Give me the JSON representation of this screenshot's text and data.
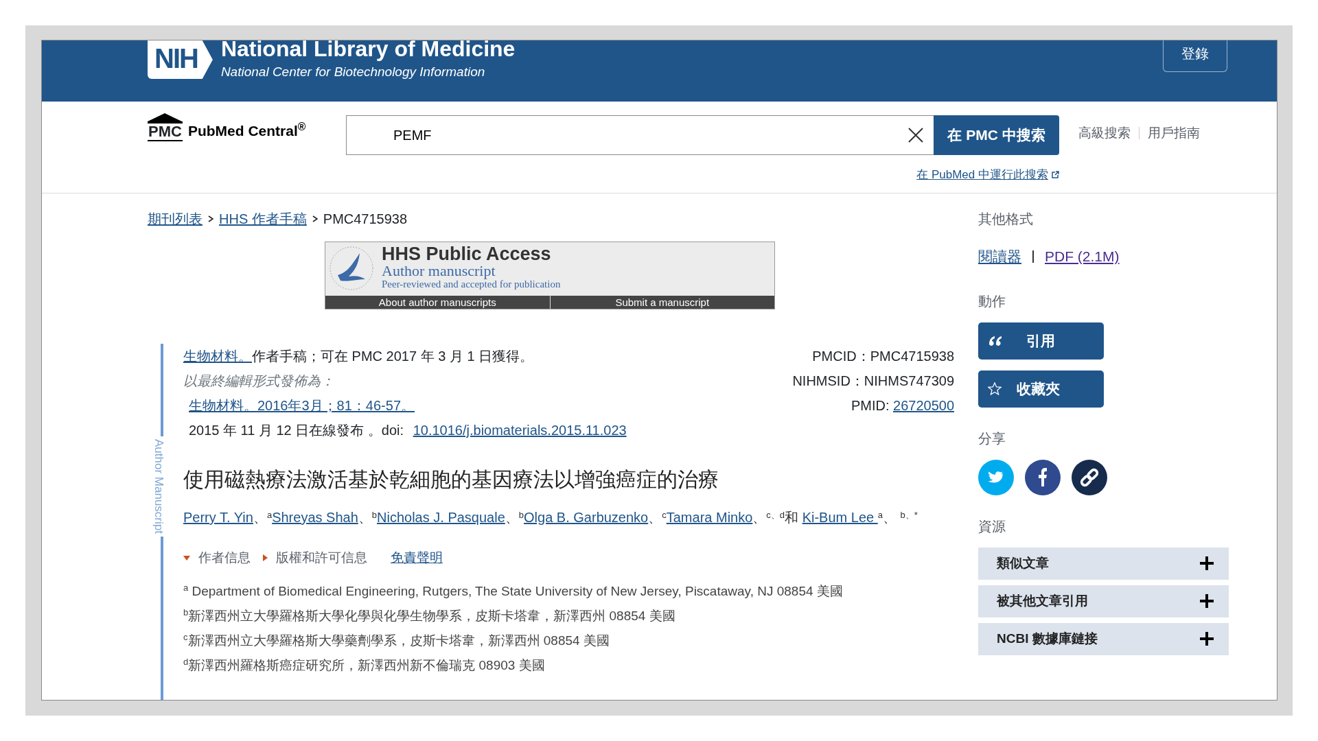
{
  "header": {
    "logo_mark": "NIH",
    "title": "National Library of Medicine",
    "subtitle": "National Center for Biotechnology Information",
    "login": "登錄"
  },
  "search_bar": {
    "logo_abbr": "PMC",
    "logo_name": "PubMed Central$^{®}$",
    "value": "PEMF",
    "button": "在 PMC 中搜索",
    "links": [
      "高級搜索",
      "用戶指南"
    ],
    "pubmed_link": "在 PubMed 中運行此搜索"
  },
  "breadcrumb": [
    {
      "label": "期刊列表",
      "kind": "link"
    },
    {
      "label": "HHS 作者手稿",
      "kind": "link"
    },
    {
      "label": "PMC4715938",
      "kind": "current"
    }
  ],
  "banner": {
    "title": "HHS Public Access",
    "subtitle": "Author manuscript",
    "note": "Peer-reviewed and accepted for publication",
    "links": [
      "About author manuscripts",
      "Submit a manuscript"
    ]
  },
  "side_label": "Author Manuscript",
  "citation": {
    "journal_link": "生物材料。",
    "availability": "作者手稿；可在 PMC 2017 年 3 月 1 日獲得。",
    "published_as": "以最終編輯形式發佈為：",
    "source_link": "生物材料。2016年3月；81：46-57。",
    "online": "2015 年 11 月 12 日在線發布 。doi: ",
    "doi": "10.1016/j.biomaterials.2015.11.023"
  },
  "ids": [
    {
      "text": "PMCID：PMC4715938"
    },
    {
      "text": "NIHMSID：NIHMS747309"
    },
    {
      "text": "PMID: ",
      "link": "26720500"
    }
  ],
  "title": "使用磁熱療法激活基於乾細胞的基因療法以增強癌症的治療",
  "authors": [
    {
      "name": "Perry T. Yin",
      "after": "、$^{a}$"
    },
    {
      "name": "Shreyas Shah",
      "after": "、$^{b}$"
    },
    {
      "name": "Nicholas J. Pasquale",
      "after": "、$^{b}$"
    },
    {
      "name": "Olga B. Garbuzenko",
      "after": "、$^{c}$"
    },
    {
      "name": "Tamara Minko",
      "after": "、$^{c、d}$和 "
    },
    {
      "name": "Ki-Bum Lee ",
      "after": "$^{a}$、 $^{b、*}$"
    }
  ],
  "sections": [
    {
      "label": "作者信息",
      "kind": "toggle",
      "expanded": true
    },
    {
      "label": "版權和許可信息",
      "kind": "toggle",
      "expanded": false
    },
    {
      "label": "免責聲明",
      "kind": "link"
    }
  ],
  "affiliations": [
    "$^{a}$ Department of Biomedical Engineering, Rutgers, The State University of New Jersey, Piscataway, NJ 08854 美國",
    "$^{b}$新澤西州立大學羅格斯大學化學與化學生物學系，皮斯卡塔韋，新澤西州 08854 美國",
    "$^{c}$新澤西州立大學羅格斯大學藥劑學系，皮斯卡塔韋，新澤西州 08854 美國",
    "$^{d}$新澤西州羅格斯癌症研究所，新澤西州新不倫瑞克 08903 美國"
  ],
  "sidebar": {
    "formats_heading": "其他格式",
    "formats": [
      {
        "label": "閱讀器",
        "visited": false
      },
      {
        "label": "PDF (2.1M)",
        "visited": true
      }
    ],
    "actions_heading": "動作",
    "actions": [
      {
        "label": "引用",
        "kind": "cite"
      },
      {
        "label": "收藏夾",
        "kind": "favorite"
      }
    ],
    "share_heading": "分享",
    "share": [
      {
        "kind": "twitter"
      },
      {
        "kind": "facebook"
      },
      {
        "kind": "link"
      }
    ],
    "resources_heading": "資源",
    "resources": [
      {
        "label": "類似文章",
        "expanded": false
      },
      {
        "label": "被其他文章引用",
        "expanded": false
      },
      {
        "label": "NCBI 數據庫鏈接",
        "expanded": false
      }
    ]
  }
}
